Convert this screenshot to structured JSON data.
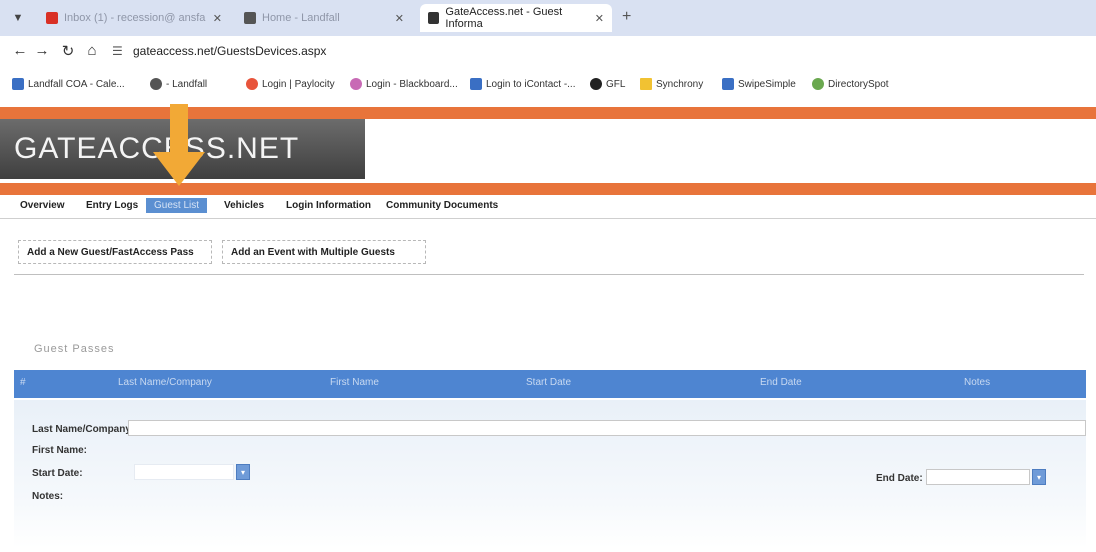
{
  "browser": {
    "tabs": [
      {
        "label": "Inbox (1) - recession@ ansfa",
        "close": "✕",
        "favicon_color": "#d93025"
      },
      {
        "label": "Home - Landfall",
        "close": "✕",
        "favicon_color": "#555555"
      },
      {
        "label": "GateAccess.net - Guest Informa",
        "close": "✕",
        "favicon_color": "#333333"
      }
    ],
    "new_tab": "+",
    "url": "gateaccess.net/GuestsDevices.aspx",
    "bookmarks": [
      {
        "label": "Landfall COA - Cale...",
        "color": "#3a6fc4"
      },
      {
        "label": "- Landfall",
        "color": "#555555"
      },
      {
        "label": "Login | Paylocity",
        "color": "#e8543b"
      },
      {
        "label": "Login - Blackboard...",
        "color": "#c86ab5"
      },
      {
        "label": "Login to iContact -...",
        "color": "#3a6fc4"
      },
      {
        "label": "GFL",
        "color": "#222222"
      },
      {
        "label": "Synchrony",
        "color": "#f1c232"
      },
      {
        "label": "SwipeSimple",
        "color": "#3a6fc4"
      },
      {
        "label": "DirectorySpot",
        "color": "#6aa84f"
      }
    ]
  },
  "site": {
    "logo": "GATEACCESS.NET",
    "nav": [
      "Overview",
      "Entry Logs",
      "Guest List",
      "Vehicles",
      "Login Information",
      "Community Documents"
    ],
    "active_nav": "Guest List",
    "actions": [
      "Add a New Guest/FastAccess Pass",
      "Add an Event with Multiple Guests"
    ],
    "section_title": "Guest Passes",
    "grid_headers": [
      "#",
      "Last Name/Company",
      "First Name",
      "Start Date",
      "End Date",
      "Notes"
    ],
    "form": {
      "last_name_label": "Last Name/Company:",
      "first_name_label": "First Name:",
      "start_date_label": "Start Date:",
      "end_date_label": "End Date:",
      "notes_label": "Notes:"
    }
  },
  "colors": {
    "orange": "#e8743b",
    "arrow": "#f2a936",
    "grid_blue": "#4e85d1"
  }
}
